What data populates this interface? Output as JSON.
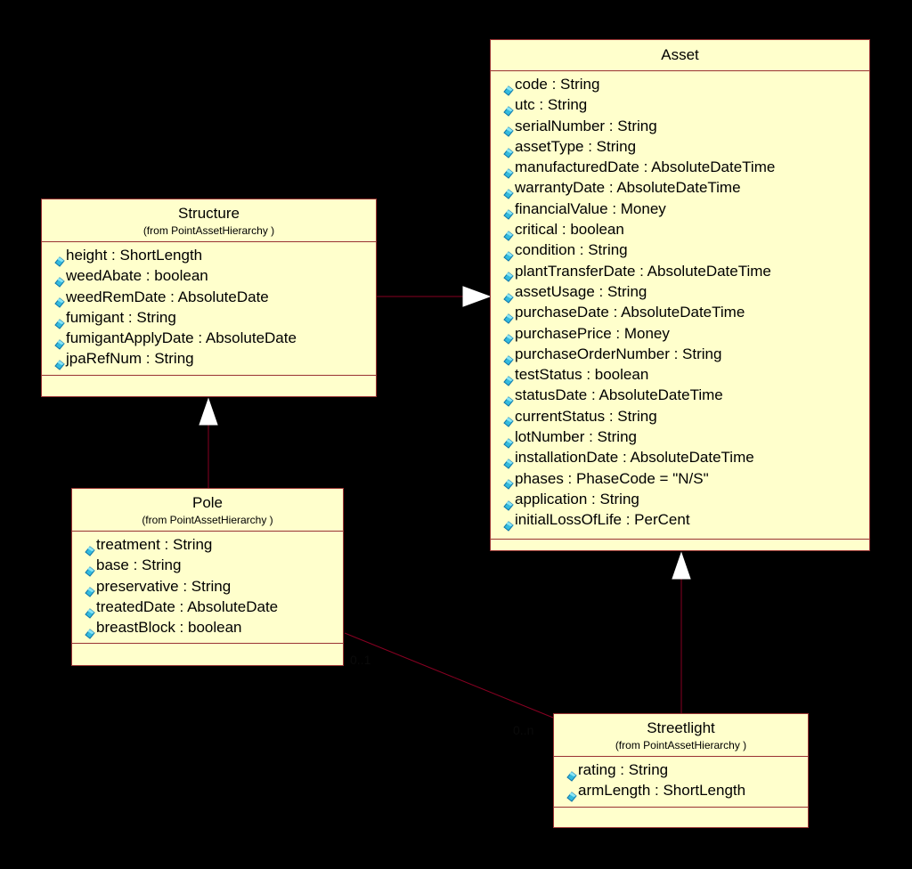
{
  "diagram": {
    "classes": {
      "asset": {
        "name": "Asset",
        "package": "",
        "attributes": [
          "code : String",
          "utc : String",
          "serialNumber : String",
          "assetType : String",
          "manufacturedDate : AbsoluteDateTime",
          "warrantyDate : AbsoluteDateTime",
          "financialValue : Money",
          "critical : boolean",
          "condition : String",
          "plantTransferDate : AbsoluteDateTime",
          "assetUsage : String",
          "purchaseDate : AbsoluteDateTime",
          "purchasePrice : Money",
          "purchaseOrderNumber : String",
          "testStatus : boolean",
          "statusDate : AbsoluteDateTime",
          "currentStatus : String",
          "lotNumber : String",
          "installationDate : AbsoluteDateTime",
          "phases : PhaseCode = \"N/S\"",
          "application : String",
          "initialLossOfLife : PerCent"
        ]
      },
      "structure": {
        "name": "Structure",
        "package": "(from PointAssetHierarchy )",
        "attributes": [
          "height : ShortLength",
          "weedAbate : boolean",
          "weedRemDate : AbsoluteDate",
          "fumigant : String",
          "fumigantApplyDate : AbsoluteDate",
          "jpaRefNum : String"
        ]
      },
      "pole": {
        "name": "Pole",
        "package": "(from PointAssetHierarchy )",
        "attributes": [
          "treatment : String",
          "base : String",
          "preservative : String",
          "treatedDate : AbsoluteDate",
          "breastBlock : boolean"
        ]
      },
      "streetlight": {
        "name": "Streetlight",
        "package": "(from PointAssetHierarchy )",
        "attributes": [
          "rating : String",
          "armLength : ShortLength"
        ]
      }
    },
    "relationships": [
      {
        "type": "generalization",
        "from": "Structure",
        "to": "Asset"
      },
      {
        "type": "generalization",
        "from": "Pole",
        "to": "Structure"
      },
      {
        "type": "generalization",
        "from": "Streetlight",
        "to": "Asset"
      },
      {
        "type": "association",
        "from": "Pole",
        "to": "Streetlight",
        "from_multiplicity": "0..1",
        "to_multiplicity": "0..n"
      }
    ],
    "icons": {
      "attribute": "public-attribute-icon"
    },
    "colors": {
      "background": "#000000",
      "class_fill": "#ffffcc",
      "class_border": "#993333",
      "connector": "#880022",
      "arrowhead": "#ffffff",
      "attribute_icon": "#33bbdd"
    }
  }
}
